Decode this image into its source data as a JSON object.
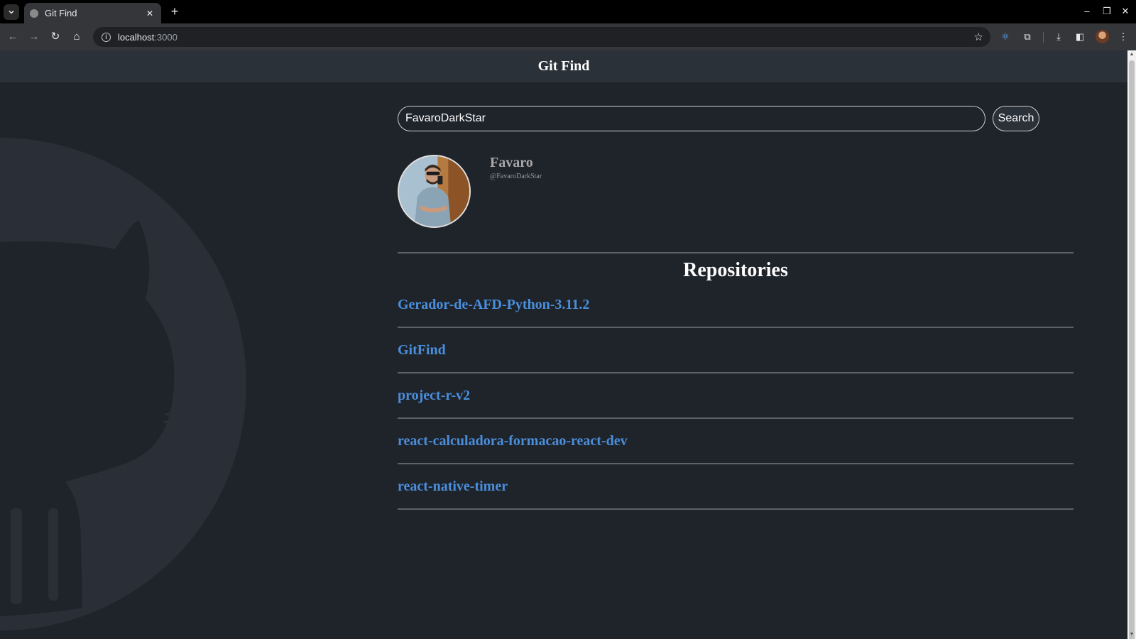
{
  "browser": {
    "tab_title": "Git Find",
    "tab_close": "✕",
    "new_tab": "+",
    "url_host": "localhost",
    "url_port": ":3000"
  },
  "app": {
    "title": "Git Find"
  },
  "search": {
    "value": "FavaroDarkStar",
    "button_label": "Search"
  },
  "profile": {
    "name": "Favaro",
    "login": "@FavaroDarkStar"
  },
  "repositories": {
    "heading": "Repositories",
    "items": [
      "Gerador-de-AFD-Python-3.11.2",
      "GitFind",
      "project-r-v2",
      "react-calculadora-formacao-react-dev",
      "react-native-timer"
    ]
  },
  "colors": {
    "page_bg": "#1f232a",
    "header_bg": "#2b3139",
    "link": "#4a8fdc",
    "divider": "#5e6168"
  },
  "icons": {
    "background": "github-octocat-icon",
    "avatar": "user-avatar"
  }
}
